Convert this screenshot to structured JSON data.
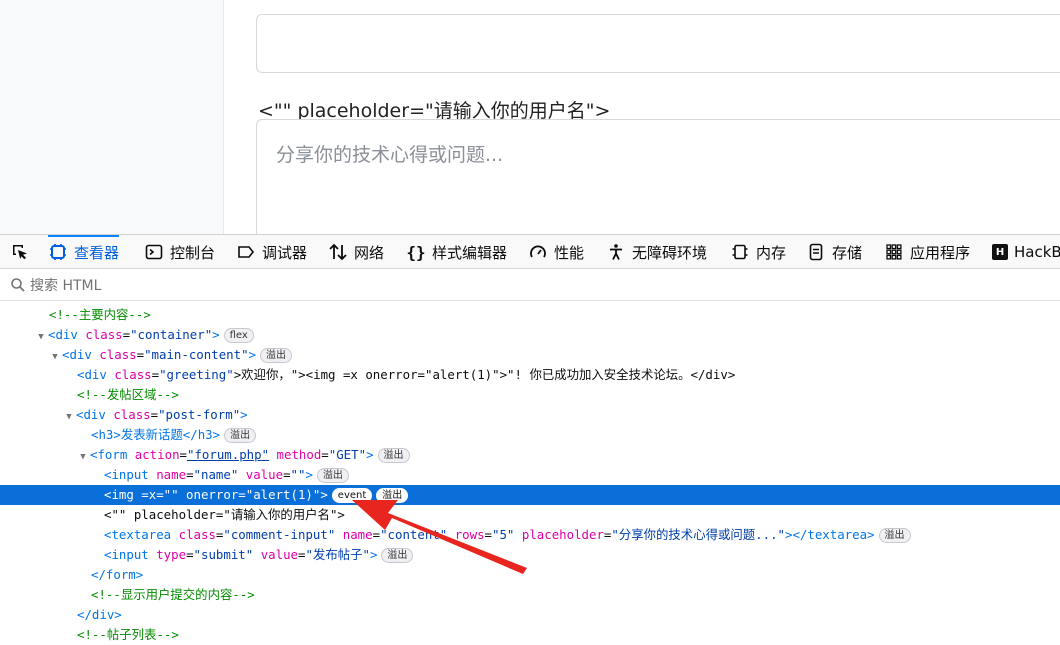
{
  "viewport": {
    "injected_text": "<\"\" placeholder=\"请输入你的用户名\">",
    "textarea_placeholder": "分享你的技术心得或问题..."
  },
  "toolbar": {
    "tabs": [
      {
        "label": "查看器",
        "icon": "inspector-icon"
      },
      {
        "label": "控制台",
        "icon": "console-icon"
      },
      {
        "label": "调试器",
        "icon": "debugger-icon"
      },
      {
        "label": "网络",
        "icon": "network-icon"
      },
      {
        "label": "样式编辑器",
        "icon": "style-editor-icon"
      },
      {
        "label": "性能",
        "icon": "performance-icon"
      },
      {
        "label": "无障碍环境",
        "icon": "accessibility-icon"
      },
      {
        "label": "内存",
        "icon": "memory-icon"
      },
      {
        "label": "存储",
        "icon": "storage-icon"
      },
      {
        "label": "应用程序",
        "icon": "application-icon"
      },
      {
        "label": "HackB",
        "icon": "hackbar-icon"
      }
    ]
  },
  "search": {
    "placeholder": "搜索 HTML"
  },
  "tree": {
    "l1": "<!--主要内容-->",
    "container_tag": "<div ",
    "container_attr": "class",
    "container_val": "\"container\"",
    "container_end": ">",
    "container_badge": "flex",
    "main_tag": "<div ",
    "main_attr": "class",
    "main_val": "\"main-content\"",
    "main_end": ">",
    "main_badge": "溢出",
    "greet_tag": "<div ",
    "greet_attr": "class",
    "greet_val": "\"greeting\"",
    "greet_end": ">欢迎你，\"><img =x onerror=\"alert(1)\">\"! 你已成功加入安全技术论坛。</div>",
    "c2": "<!--发帖区域-->",
    "post_tag": "<div ",
    "post_attr": "class",
    "post_val": "\"post-form\"",
    "post_end": ">",
    "h3_text": "<h3>发表新话题</h3>",
    "h3_badge": "溢出",
    "form_tag": "<form ",
    "form_a1": "action",
    "form_v1": "\"forum.php\"",
    "form_a2": "method",
    "form_v2": "\"GET\"",
    "form_end": ">",
    "form_badge": "溢出",
    "in1_tag": "<input ",
    "in1_a1": "name",
    "in1_v1": "\"name\"",
    "in1_a2": "value",
    "in1_v2": "\"\"",
    "in1_end": ">",
    "in1_badge": "溢出",
    "img_text": "<img =x=\"\" onerror=\"alert(1)\">",
    "img_badge1": "event",
    "img_badge2": "溢出",
    "txt_line": "<\"\" placeholder=\"请输入你的用户名\">",
    "ta_tag": "<textarea ",
    "ta_a1": "class",
    "ta_v1": "\"comment-input\"",
    "ta_a2": "name",
    "ta_v2": "\"content\"",
    "ta_a3": "rows",
    "ta_v3": "\"5\"",
    "ta_a4": "placeholder",
    "ta_v4": "\"分享你的技术心得或问题...\"",
    "ta_end": "></textarea>",
    "ta_badge": "溢出",
    "sub_tag": "<input ",
    "sub_a1": "type",
    "sub_v1": "\"submit\"",
    "sub_a2": "value",
    "sub_v2": "\"发布帖子\"",
    "sub_end": ">",
    "sub_badge": "溢出",
    "form_close": "</form>",
    "c3": "<!--显示用户提交的内容-->",
    "div_close": "</div>",
    "c4": "<!--帖子列表-->"
  },
  "colors": {
    "selection": "#0a6fd8",
    "tag": "#0074e8",
    "attr_name": "#dd00a9",
    "attr_value": "#003eaa",
    "comment": "#058b00",
    "annotation_arrow": "#e8251f"
  }
}
